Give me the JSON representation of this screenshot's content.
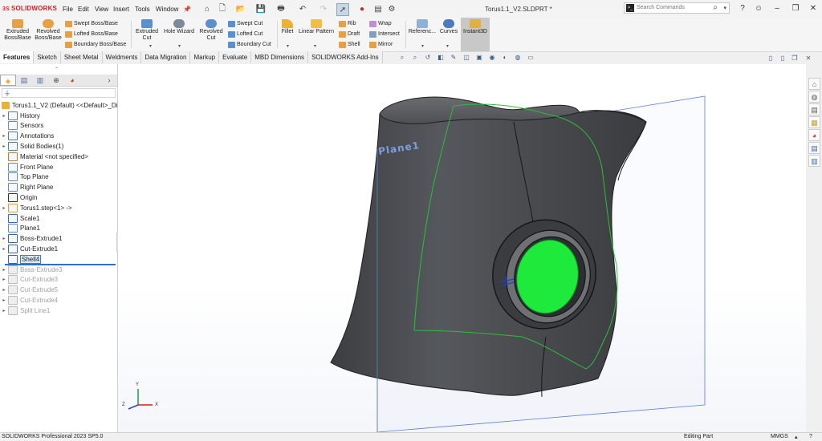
{
  "app": {
    "logo_text": "SOLIDWORKS",
    "logo_prefix": "3S",
    "document_title": "Torus1.1_V2.SLDPRT *"
  },
  "menu": [
    "File",
    "Edit",
    "View",
    "Insert",
    "Tools",
    "Window"
  ],
  "search": {
    "placeholder": "Search Commands"
  },
  "ribbon": {
    "extruded_boss": "Extruded Boss/Base",
    "revolved_boss": "Revolved Boss/Base",
    "swept_boss": "Swept Boss/Base",
    "lofted_boss": "Lofted Boss/Base",
    "boundary_boss": "Boundary Boss/Base",
    "extruded_cut": "Extruded Cut",
    "hole_wizard": "Hole Wizard",
    "revolved_cut": "Revolved Cut",
    "swept_cut": "Swept Cut",
    "lofted_cut": "Lofted Cut",
    "boundary_cut": "Boundary Cut",
    "fillet": "Fillet",
    "linear_pattern": "Linear Pattern",
    "rib": "Rib",
    "draft": "Draft",
    "shell": "Shell",
    "wrap": "Wrap",
    "intersect": "Intersect",
    "mirror": "Mirror",
    "reference": "Referenc...",
    "curves": "Curves",
    "instant3d": "Instant3D"
  },
  "tabs": [
    "Features",
    "Sketch",
    "Sheet Metal",
    "Weldments",
    "Data Migration",
    "Markup",
    "Evaluate",
    "MBD Dimensions",
    "SOLIDWORKS Add-Ins"
  ],
  "tree": {
    "root": "Torus1.1_V2 (Default) <<Default>_Di",
    "items": [
      {
        "label": "History",
        "icon": "history-icon",
        "expand": true,
        "state": "normal"
      },
      {
        "label": "Sensors",
        "icon": "sensors-icon",
        "expand": false,
        "state": "normal"
      },
      {
        "label": "Annotations",
        "icon": "annotations-icon",
        "expand": true,
        "state": "normal"
      },
      {
        "label": "Solid Bodies(1)",
        "icon": "solid-bodies-icon",
        "expand": true,
        "state": "normal"
      },
      {
        "label": "Material <not specified>",
        "icon": "material-icon",
        "expand": false,
        "state": "normal"
      },
      {
        "label": "Front Plane",
        "icon": "plane-icon",
        "expand": false,
        "state": "normal"
      },
      {
        "label": "Top Plane",
        "icon": "plane-icon",
        "expand": false,
        "state": "normal"
      },
      {
        "label": "Right Plane",
        "icon": "plane-icon",
        "expand": false,
        "state": "normal"
      },
      {
        "label": "Origin",
        "icon": "origin-icon",
        "expand": false,
        "state": "normal"
      },
      {
        "label": "Torus1.step<1> ->",
        "icon": "imported-part-icon",
        "expand": true,
        "state": "normal"
      },
      {
        "label": "Scale1",
        "icon": "scale-icon",
        "expand": false,
        "state": "normal"
      },
      {
        "label": "Plane1",
        "icon": "plane-icon",
        "expand": false,
        "state": "normal"
      },
      {
        "label": "Boss-Extrude1",
        "icon": "boss-extrude-icon",
        "expand": true,
        "state": "normal"
      },
      {
        "label": "Cut-Extrude1",
        "icon": "cut-extrude-icon",
        "expand": true,
        "state": "normal"
      },
      {
        "label": "Shell4",
        "icon": "shell-icon",
        "expand": false,
        "state": "selected"
      },
      {
        "label": "Boss-Extrude3",
        "icon": "boss-extrude-icon",
        "expand": true,
        "state": "suppressed"
      },
      {
        "label": "Cut-Extrude3",
        "icon": "cut-extrude-icon",
        "expand": true,
        "state": "suppressed"
      },
      {
        "label": "Cut-Extrude5",
        "icon": "cut-extrude-icon",
        "expand": true,
        "state": "suppressed"
      },
      {
        "label": "Cut-Extrude4",
        "icon": "cut-extrude-icon",
        "expand": true,
        "state": "suppressed"
      },
      {
        "label": "Split Line1",
        "icon": "split-line-icon",
        "expand": true,
        "state": "suppressed"
      }
    ]
  },
  "viewport": {
    "plane_label": "Plane1",
    "triad_x": "X",
    "triad_y": "Y",
    "triad_z": "Z"
  },
  "status": {
    "left": "SOLIDWORKS Professional 2023 SP5.0",
    "mode": "Editing Part",
    "units": "MMGS"
  },
  "colors": {
    "accent": "#d42027",
    "selection": "#3c7fc4",
    "face_highlight": "#22dd44",
    "plane": "#4a6ad0",
    "body": "#4b4d50"
  }
}
